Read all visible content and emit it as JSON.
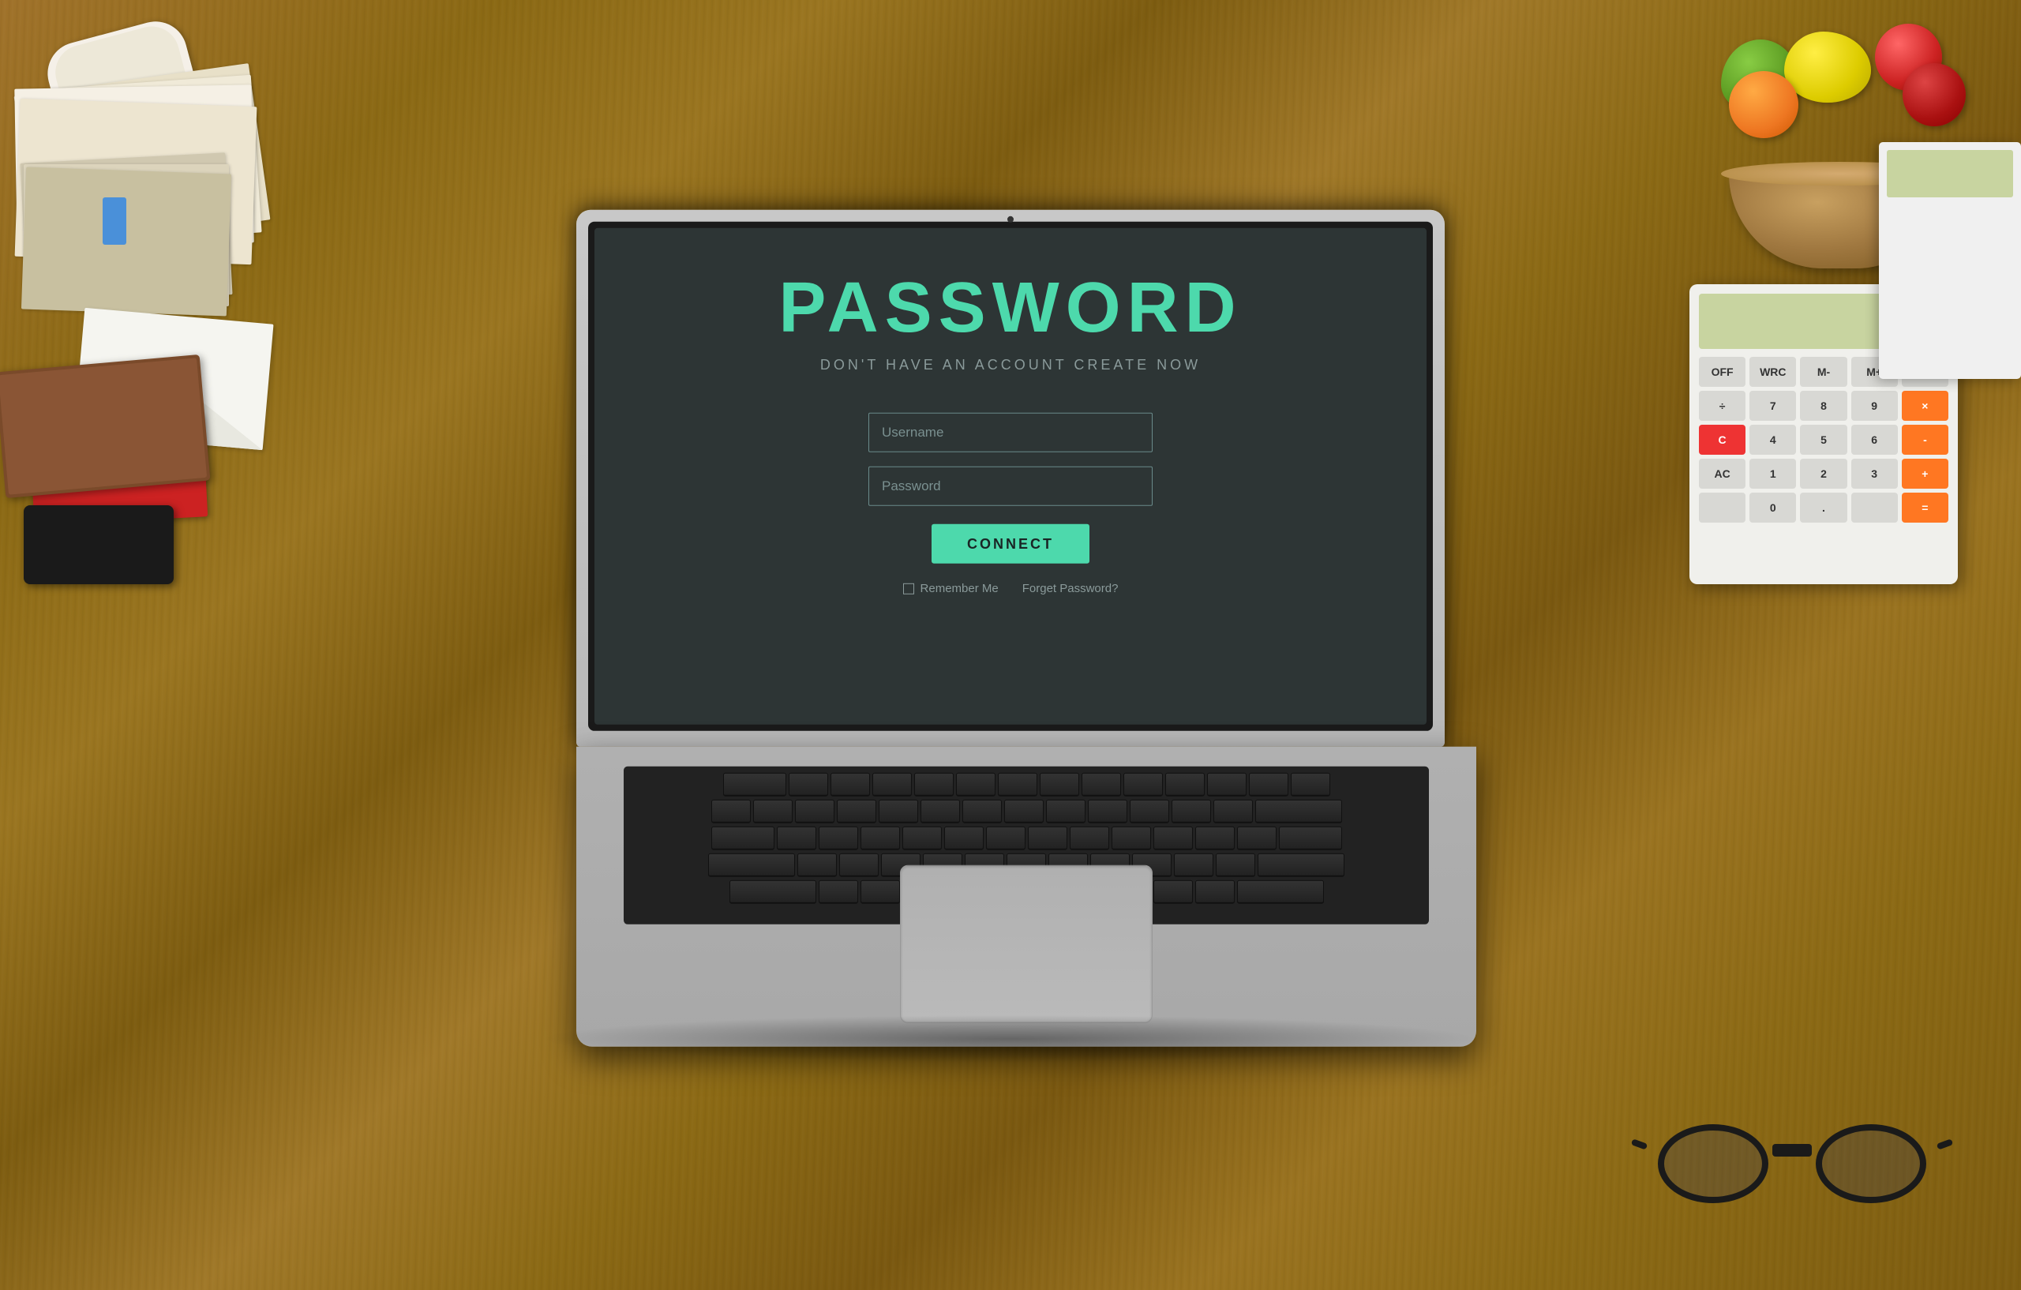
{
  "screen": {
    "title": "PASSWORD",
    "subtitle": "DON'T HAVE AN ACCOUNT CREATE NOW",
    "username_placeholder": "Username",
    "password_placeholder": "Password",
    "connect_button": "CONNECT",
    "remember_me": "Remember Me",
    "forget_password": "Forget Password?"
  },
  "calculator": {
    "display_value": ""
  }
}
